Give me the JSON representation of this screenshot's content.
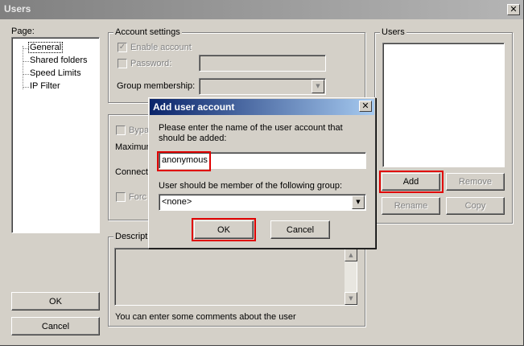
{
  "window": {
    "title": "Users",
    "close_glyph": "✕"
  },
  "page_panel": {
    "label": "Page:",
    "items": [
      {
        "label": "General",
        "selected": true
      },
      {
        "label": "Shared folders"
      },
      {
        "label": "Speed Limits"
      },
      {
        "label": "IP Filter"
      }
    ],
    "ok_label": "OK",
    "cancel_label": "Cancel"
  },
  "account_settings": {
    "label": "Account settings",
    "enable_account_label": "Enable account",
    "enable_account_checked": true,
    "password_label": "Password:",
    "password_value": "",
    "group_membership_label": "Group membership:",
    "group_membership_value": ""
  },
  "partial_group": {
    "bypass_label": "Bypa",
    "maximum_label": "Maximum",
    "connect_label": "Connect",
    "force_label": "Forc"
  },
  "description": {
    "label": "Descripti",
    "value": "",
    "hint": "You can enter some comments about the user"
  },
  "users_panel": {
    "label": "Users",
    "items": [],
    "add_label": "Add",
    "remove_label": "Remove",
    "rename_label": "Rename",
    "copy_label": "Copy"
  },
  "dialog": {
    "title": "Add user account",
    "close_glyph": "✕",
    "prompt": "Please enter the name of the user account that should be added:",
    "name_value": "anonymous",
    "group_prompt": "User should be member of the following group:",
    "group_value": "<none>",
    "ok_label": "OK",
    "cancel_label": "Cancel"
  },
  "icons": {
    "dropdown": "▼",
    "scroll_up": "▲",
    "scroll_down": "▼",
    "check": "✓"
  },
  "colors": {
    "highlight": "#e00000",
    "dialog_title": "#0a246a",
    "window_face": "#d4d0c8"
  }
}
